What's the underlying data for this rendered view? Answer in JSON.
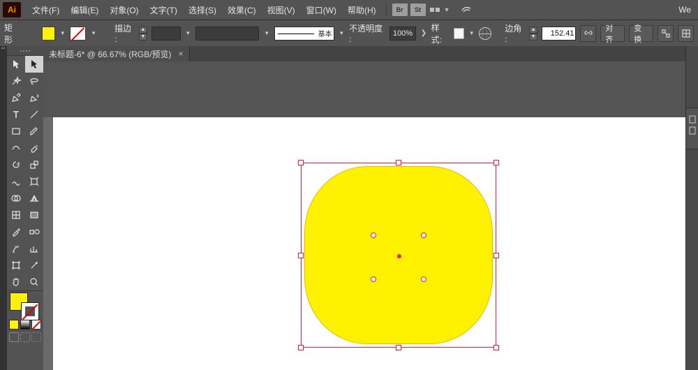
{
  "app": {
    "logo": "Ai",
    "workspace_hint": "We"
  },
  "menu": {
    "file": "文件(F)",
    "edit": "编辑(E)",
    "object": "对象(O)",
    "type": "文字(T)",
    "select": "选择(S)",
    "effect": "效果(C)",
    "view": "视图(V)",
    "window": "窗口(W)",
    "help": "帮助(H)"
  },
  "bridge_btn": "Br",
  "stock_btn": "St",
  "options": {
    "shape_label": "矩形",
    "stroke_label": "描边 :",
    "brush_profile_label": "基本",
    "opacity_label": "不透明度 :",
    "opacity_value": "100%",
    "style_label": "样式:",
    "corner_label": "边角 :",
    "corner_value": "152.41",
    "align_btn": "对齐",
    "transform_btn": "变换",
    "fill_color": "#fff200"
  },
  "doc_tab": {
    "title": "未标题-6* @ 66.67% (RGB/预览)",
    "close": "×"
  },
  "shape": {
    "fill": "#fff200"
  }
}
